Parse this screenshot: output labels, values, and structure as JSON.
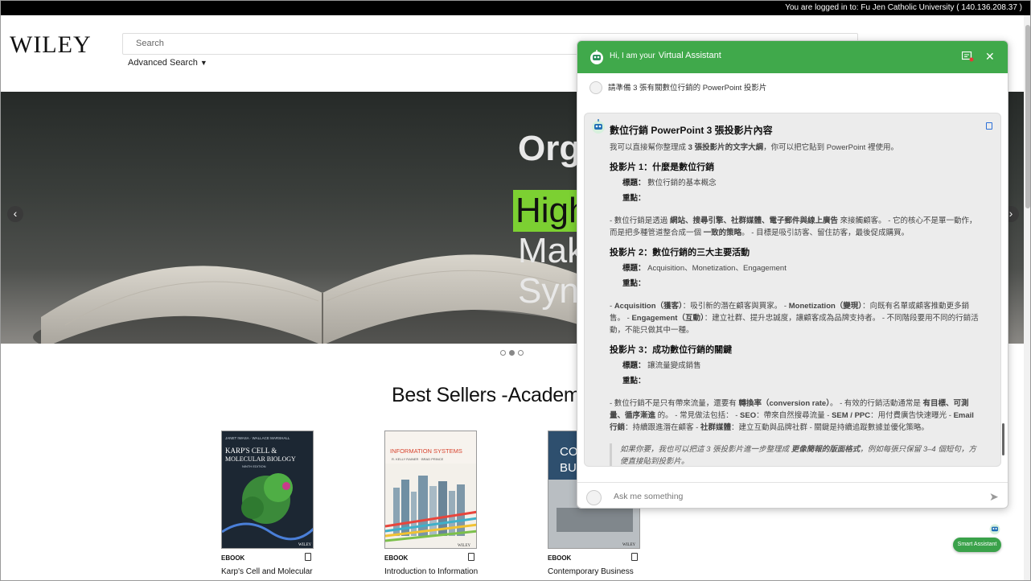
{
  "topbar": {
    "login_text": "You are logged in to: Fu Jen Catholic University ( 140.136.208.37 )"
  },
  "header": {
    "logo": "WILEY",
    "search_placeholder": "Search",
    "advanced_search": "Advanced Search"
  },
  "hero": {
    "lines": [
      "Org",
      "High",
      "Mak",
      "Syn"
    ],
    "highlight_color": "#7cd032"
  },
  "carousel": {
    "total_dots": 3,
    "active_dot": 2
  },
  "bestsellers": {
    "heading": "Best Sellers -Academi",
    "books": [
      {
        "format": "EBOOK",
        "title": "Karp's Cell and Molecular"
      },
      {
        "format": "EBOOK",
        "title": "Introduction to Information"
      },
      {
        "format": "EBOOK",
        "title": "Contemporary Business"
      }
    ],
    "covers": [
      {
        "title_line1": "KARP'S CELL &",
        "title_line2": "MOLECULAR BIOLOGY",
        "authors": "JANET IWASA · WALLACE MARSHALL",
        "edition": "NINTH EDITION",
        "publisher": "WILEY"
      },
      {
        "title": "INFORMATION SYSTEMS",
        "authors": "R. KELLY RAINER · BRAD PRINCE",
        "publisher": "WILEY"
      },
      {
        "title_line1": "CON",
        "title_line2": "BU",
        "publisher": "WILEY"
      }
    ]
  },
  "chat": {
    "greeting": "Hi, I am your",
    "assistant_name": "Virtual Assistant",
    "accent_color": "#40a94b",
    "user_message": "請準備 3 張有關數位行銷的 PowerPoint 投影片",
    "response": {
      "heading": "數位行銷 PowerPoint 3 張投影片內容",
      "intro_a": "我可以直接幫你整理成",
      "intro_b": "3 張投影片的文字大綱",
      "intro_c": "，你可以把它貼到 PowerPoint 裡使用。",
      "title_label": "標題：",
      "points_label": "重點：",
      "slides": [
        {
          "heading": "投影片 1：什麼是數位行銷",
          "title": "數位行銷的基本概念",
          "body": [
            {
              "t": "- 數位行銷是透過 "
            },
            {
              "t": "網站、搜尋引擎、社群媒體、電子郵件與線上廣告",
              "b": true
            },
            {
              "t": " 來接觸顧客。 - 它的核心不是單一動作，而是把多種管道整合成一個 "
            },
            {
              "t": "一致的策略",
              "b": true
            },
            {
              "t": "。 - 目標是吸引訪客、留住訪客，最後促成購買。"
            }
          ]
        },
        {
          "heading": "投影片 2：數位行銷的三大主要活動",
          "title": "Acquisition、Monetization、Engagement",
          "body": [
            {
              "t": "- "
            },
            {
              "t": "Acquisition（獲客）",
              "b": true
            },
            {
              "t": "：吸引新的潛在顧客與買家。 - "
            },
            {
              "t": "Monetization（變現）",
              "b": true
            },
            {
              "t": "：向既有名單或顧客推動更多銷售。 - "
            },
            {
              "t": "Engagement（互動）",
              "b": true
            },
            {
              "t": "：建立社群、提升忠誠度，讓顧客成為品牌支持者。 - 不同階段要用不同的行銷活動，不能只做其中一種。"
            }
          ]
        },
        {
          "heading": "投影片 3：成功數位行銷的關鍵",
          "title": "讓流量變成銷售",
          "body": [
            {
              "t": "- 數位行銷不是只有帶來流量，還要有 "
            },
            {
              "t": "轉換率（conversion rate）",
              "b": true
            },
            {
              "t": "。 - 有效的行銷活動通常是 "
            },
            {
              "t": "有目標、可測量、循序漸進",
              "b": true
            },
            {
              "t": " 的。 - 常見做法包括： - "
            },
            {
              "t": "SEO",
              "b": true
            },
            {
              "t": "：帶來自然搜尋流量 - "
            },
            {
              "t": "SEM / PPC",
              "b": true
            },
            {
              "t": "：用付費廣告快速曝光 - "
            },
            {
              "t": "Email 行銷",
              "b": true
            },
            {
              "t": "：持續跟進潛在顧客 - "
            },
            {
              "t": "社群媒體",
              "b": true
            },
            {
              "t": "：建立互動與品牌社群 - 關鍵是持續追蹤數據並優化策略。"
            }
          ]
        }
      ],
      "followup": [
        {
          "t": "如果你要，我也可以把這 3 張投影片進一步整理成 "
        },
        {
          "t": "更像簡報的版面格式",
          "b": true
        },
        {
          "t": "，例如每張只保留 3–4 個短句，方便直接貼到投影片。"
        }
      ]
    },
    "input_placeholder": "Ask me something"
  },
  "smart_assistant": {
    "label": "Smart Assistant"
  }
}
